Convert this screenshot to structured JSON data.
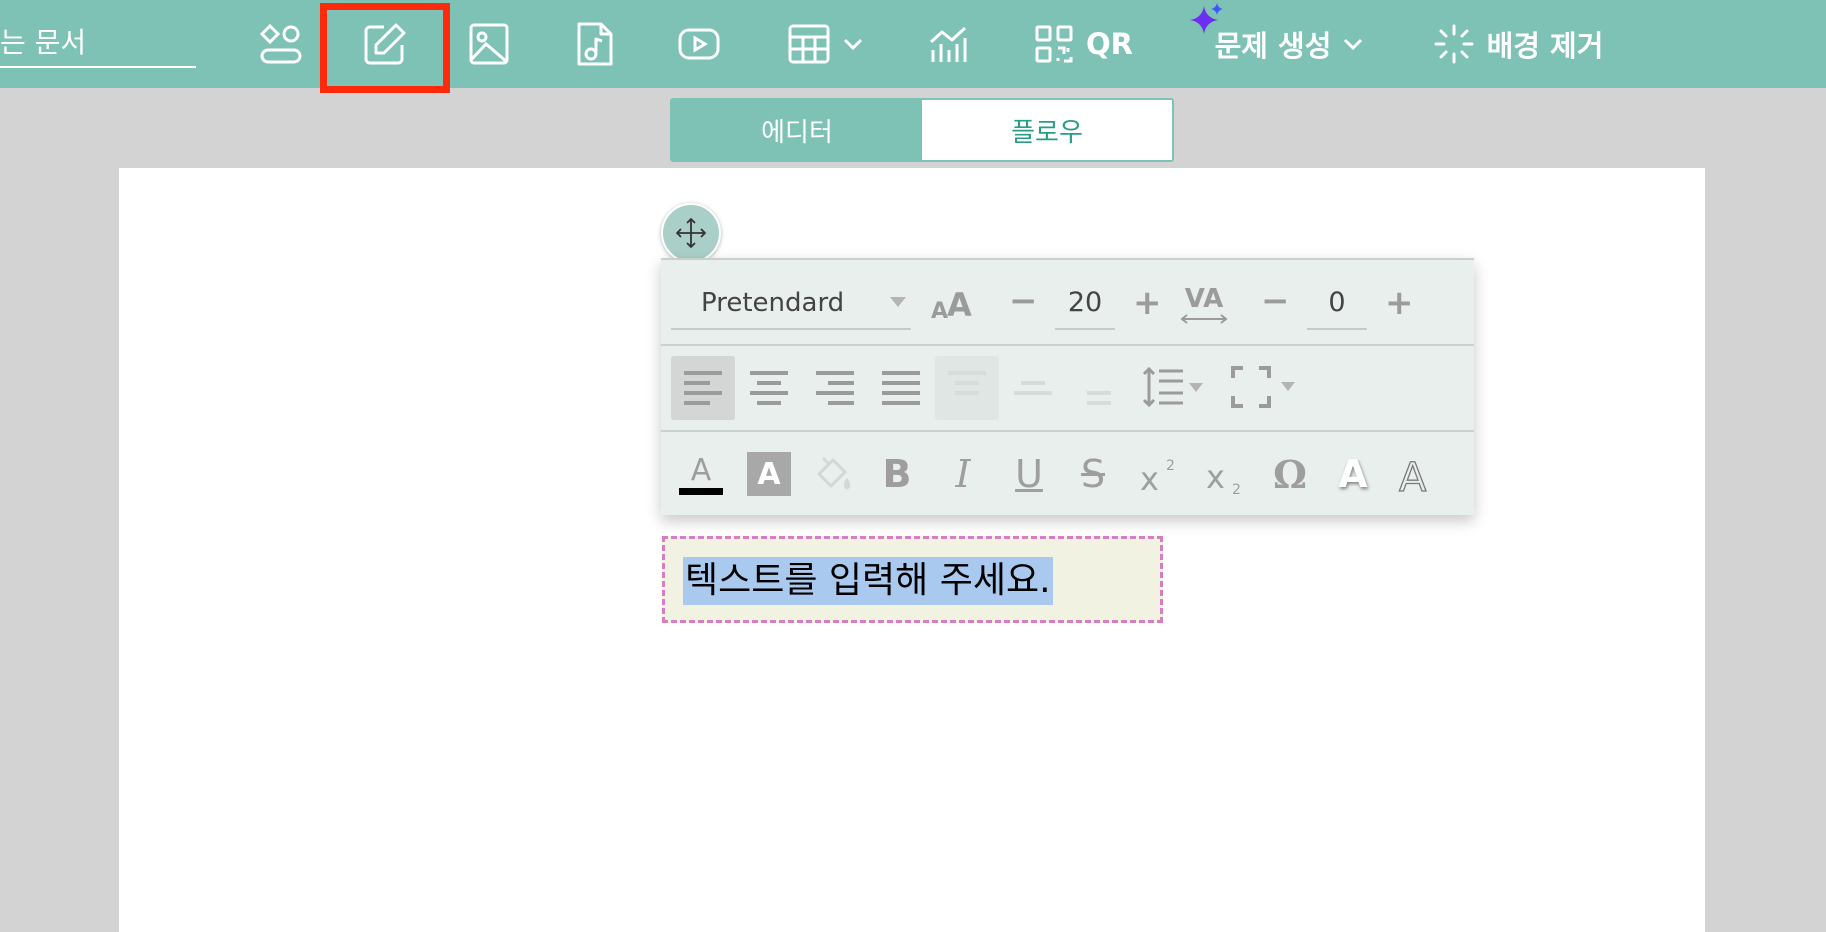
{
  "toolbar": {
    "document_title": "는 문서",
    "qr_label": "QR",
    "problem_label": "문제 생성",
    "bg_remove_label": "배경 제거",
    "accent_color": "#7dc2b4",
    "highlight_color": "#ff2a0b",
    "icons": [
      "shapes-icon",
      "edit-icon",
      "image-icon",
      "audio-file-icon",
      "video-icon",
      "table-icon",
      "chart-icon",
      "qr-icon",
      "ai-sparkle-icon",
      "background-remove-icon"
    ]
  },
  "mode_switch": {
    "editor_label": "에디터",
    "flow_label": "플로우",
    "active": "에디터"
  },
  "format_panel": {
    "font_name": "Pretendard",
    "font_size": "20",
    "letter_spacing": "0",
    "minus": "−",
    "plus": "+",
    "va_label": "VA",
    "text_color": "#000000"
  },
  "text_box": {
    "content": "텍스트를 입력해 주세요."
  }
}
